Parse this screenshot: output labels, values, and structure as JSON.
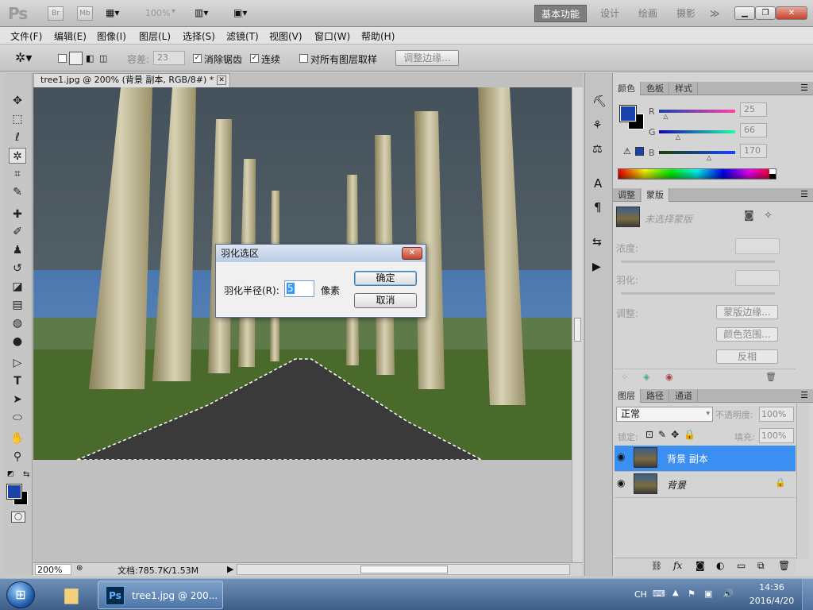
{
  "app": {
    "logo": "Ps",
    "bridge": "Br",
    "mini_bridge": "Mb",
    "zoom_display": "100%"
  },
  "workspaces": {
    "active": "基本功能",
    "items": [
      "设计",
      "绘画",
      "摄影"
    ],
    "more": "≫"
  },
  "menu": [
    "文件(F)",
    "编辑(E)",
    "图像(I)",
    "图层(L)",
    "选择(S)",
    "滤镜(T)",
    "视图(V)",
    "窗口(W)",
    "帮助(H)"
  ],
  "options": {
    "tolerance_label": "容差:",
    "tolerance_value": "23",
    "antialias_label": "消除锯齿",
    "contiguous_label": "连续",
    "sample_all_label": "对所有图层取样",
    "refine_edge_label": "调整边缘..."
  },
  "document": {
    "tab_title": "tree1.jpg @ 200% (背景 副本, RGB/8#) *",
    "zoom": "200%",
    "doc_size": "文档:785.7K/1.53M"
  },
  "dialog": {
    "title": "羽化选区",
    "radius_label": "羽化半径(R):",
    "radius_value": "5",
    "unit": "像素",
    "ok": "确定",
    "cancel": "取消"
  },
  "color_panel": {
    "tabs": [
      "颜色",
      "色板",
      "样式"
    ],
    "r_label": "R",
    "r_value": "25",
    "g_label": "G",
    "g_value": "66",
    "b_label": "B",
    "b_value": "170",
    "r_fraction": 0.098,
    "g_fraction": 0.259,
    "b_fraction": 0.667,
    "foreground": "#1942aa"
  },
  "masks_panel": {
    "tabs": [
      "调整",
      "蒙版"
    ],
    "no_mask": "未选择蒙版",
    "density_label": "浓度:",
    "feather_label": "羽化:",
    "adjust_label": "调整:",
    "mask_edge": "蒙版边缘...",
    "color_range": "颜色范围...",
    "invert": "反相"
  },
  "layers_panel": {
    "tabs": [
      "图层",
      "路径",
      "通道"
    ],
    "blend_mode": "正常",
    "opacity_label": "不透明度:",
    "opacity_value": "100%",
    "lock_label": "锁定:",
    "fill_label": "填充:",
    "fill_value": "100%",
    "layers": [
      {
        "name": "背景 副本",
        "selected": true
      },
      {
        "name": "背景",
        "selected": false,
        "locked": true
      }
    ]
  },
  "taskbar": {
    "task_label": "tree1.jpg @ 200...",
    "ime": "CH",
    "time": "14:36",
    "date": "2016/4/20"
  },
  "colors": {
    "accent": "#1942aa",
    "selected_layer": "#3a8ff0"
  }
}
